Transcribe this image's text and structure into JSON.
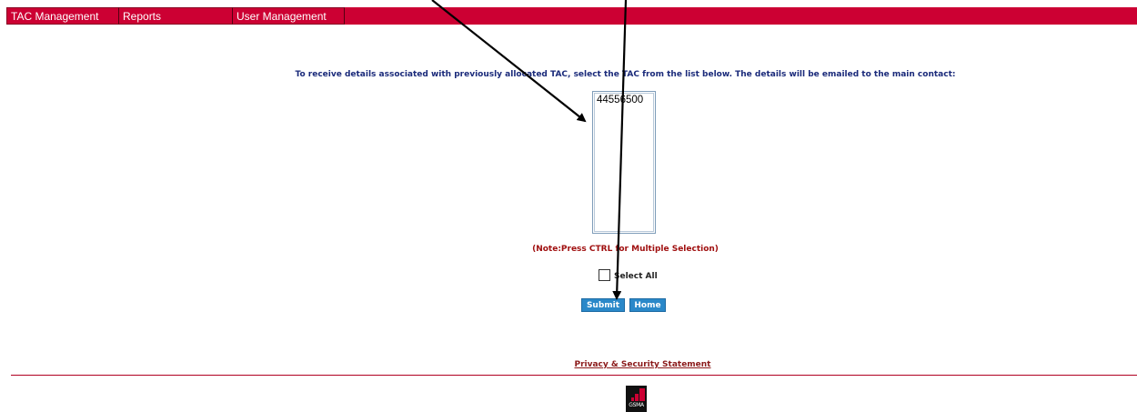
{
  "menu": {
    "items": [
      {
        "label": "TAC Management"
      },
      {
        "label": "Reports"
      },
      {
        "label": "User Management"
      }
    ]
  },
  "main": {
    "instruction": "To receive details associated with previously allocated TAC, select the TAC from the list below. The details will be emailed to the main contact:",
    "tac_options": [
      "44556500"
    ],
    "note": "(Note:Press CTRL for Multiple Selection)",
    "select_all_label": "Select All",
    "select_all_checked": false,
    "submit_label": "Submit",
    "home_label": "Home"
  },
  "footer": {
    "privacy_link": "Privacy & Security Statement",
    "logo_text": "GSMA"
  },
  "colors": {
    "brand_red": "#cc0033",
    "button_blue": "#2a88c9",
    "instruction_text": "#1a2a7a",
    "note_text": "#a01010"
  }
}
